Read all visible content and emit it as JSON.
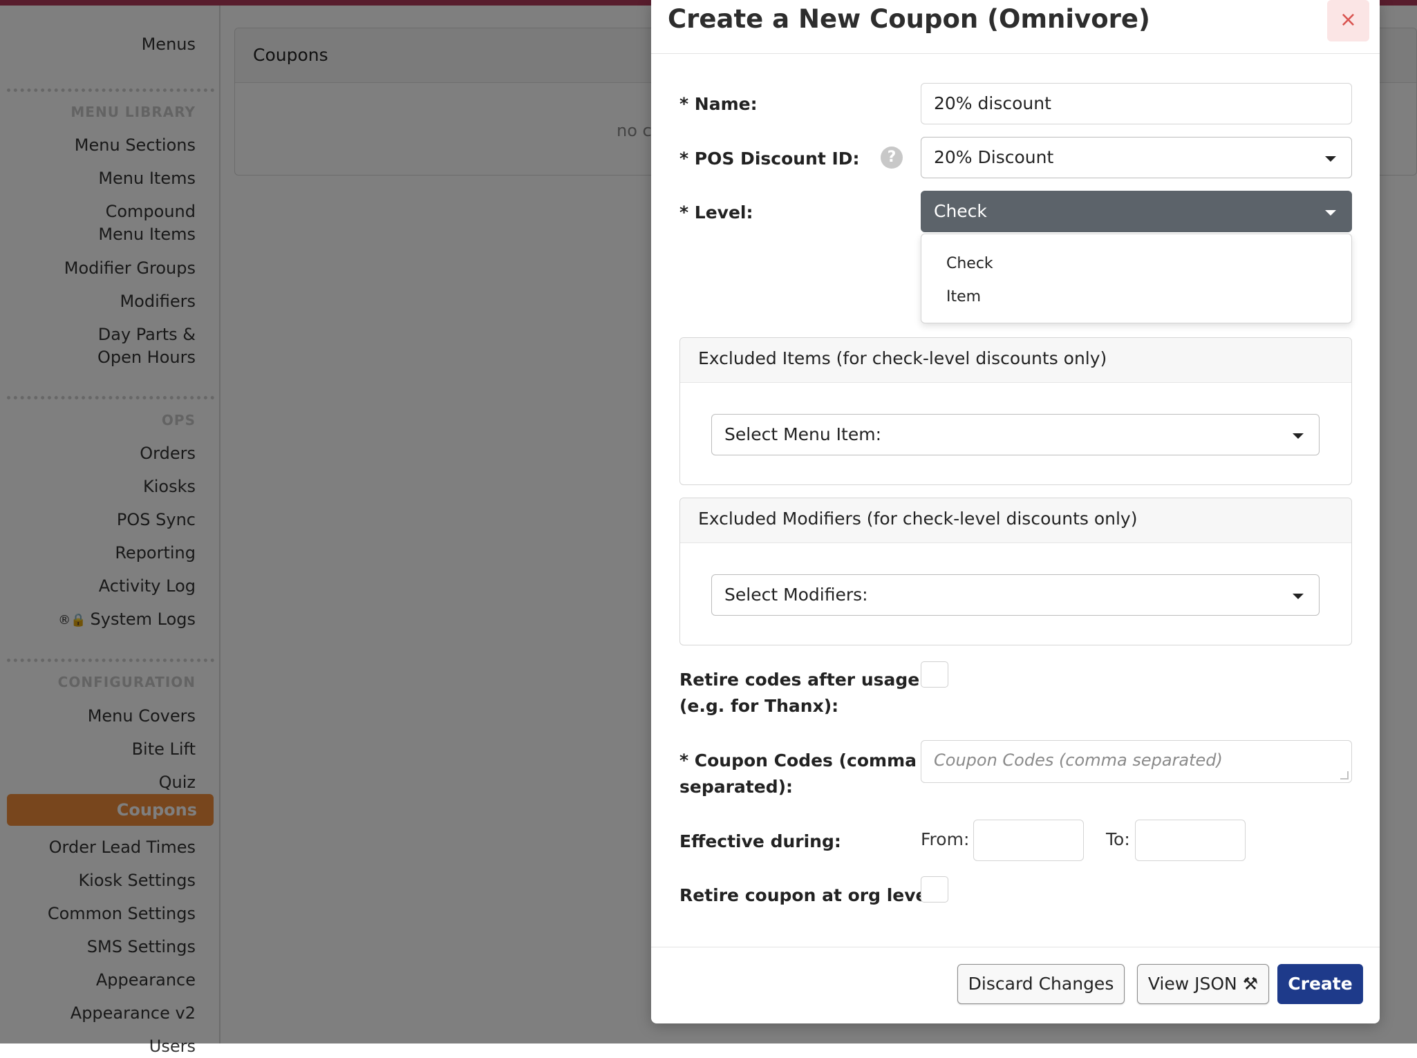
{
  "sidebar": {
    "top_item": "Menus",
    "sections": [
      {
        "heading": "MENU LIBRARY",
        "items": [
          "Menu Sections",
          "Menu Items",
          "Compound Menu Items",
          "Modifier Groups",
          "Modifiers",
          "Day Parts & Open Hours"
        ]
      },
      {
        "heading": "OPS",
        "items": [
          "Orders",
          "Kiosks",
          "POS Sync",
          "Reporting",
          "Activity Log",
          "System Logs"
        ]
      },
      {
        "heading": "CONFIGURATION",
        "items": [
          "Menu Covers",
          "Bite Lift",
          "Quiz",
          "Coupons",
          "Order Lead Times",
          "Kiosk Settings",
          "Common Settings",
          "SMS Settings",
          "Appearance",
          "Appearance v2",
          "Users"
        ]
      }
    ],
    "compound_line1": "Compound",
    "compound_line2": "Menu Items",
    "dayparts_line1": "Day Parts &",
    "dayparts_line2": "Open Hours",
    "system_logs_prefix": "®🔒",
    "active_item": "Coupons"
  },
  "main": {
    "panel_title": "Coupons",
    "empty_text": "no c"
  },
  "modal": {
    "title": "Create a New Coupon (Omnivore)",
    "close_glyph": "×",
    "fields": {
      "name_label": "* Name:",
      "name_value": "20% discount",
      "pos_label": "* POS Discount ID:",
      "pos_value": "20% Discount",
      "help_glyph": "?",
      "level_label": "* Level:",
      "level_value": "Check",
      "level_options": [
        "Check",
        "Item"
      ],
      "excluded_items_title": "Excluded Items (for check-level discounts only)",
      "excluded_items_select": "Select Menu Item:",
      "excluded_mods_title": "Excluded Modifiers (for check-level discounts only)",
      "excluded_mods_select": "Select Modifiers:",
      "retire_codes_label_1": "Retire codes after usage",
      "retire_codes_label_2": "(e.g. for Thanx):",
      "coupon_codes_label_1": "* Coupon Codes (comma",
      "coupon_codes_label_2": "separated):",
      "coupon_codes_placeholder": "Coupon Codes (comma separated)",
      "effective_label": "Effective during:",
      "from_label": "From:",
      "to_label": "To:",
      "retire_org_label": "Retire coupon at org level:"
    },
    "buttons": {
      "discard": "Discard Changes",
      "view_json": "View JSON ⚒",
      "create": "Create"
    }
  },
  "colors": {
    "active_nav": "#f08c3a",
    "primary_button": "#1e3a8a",
    "top_accent": "#b03a5b"
  }
}
